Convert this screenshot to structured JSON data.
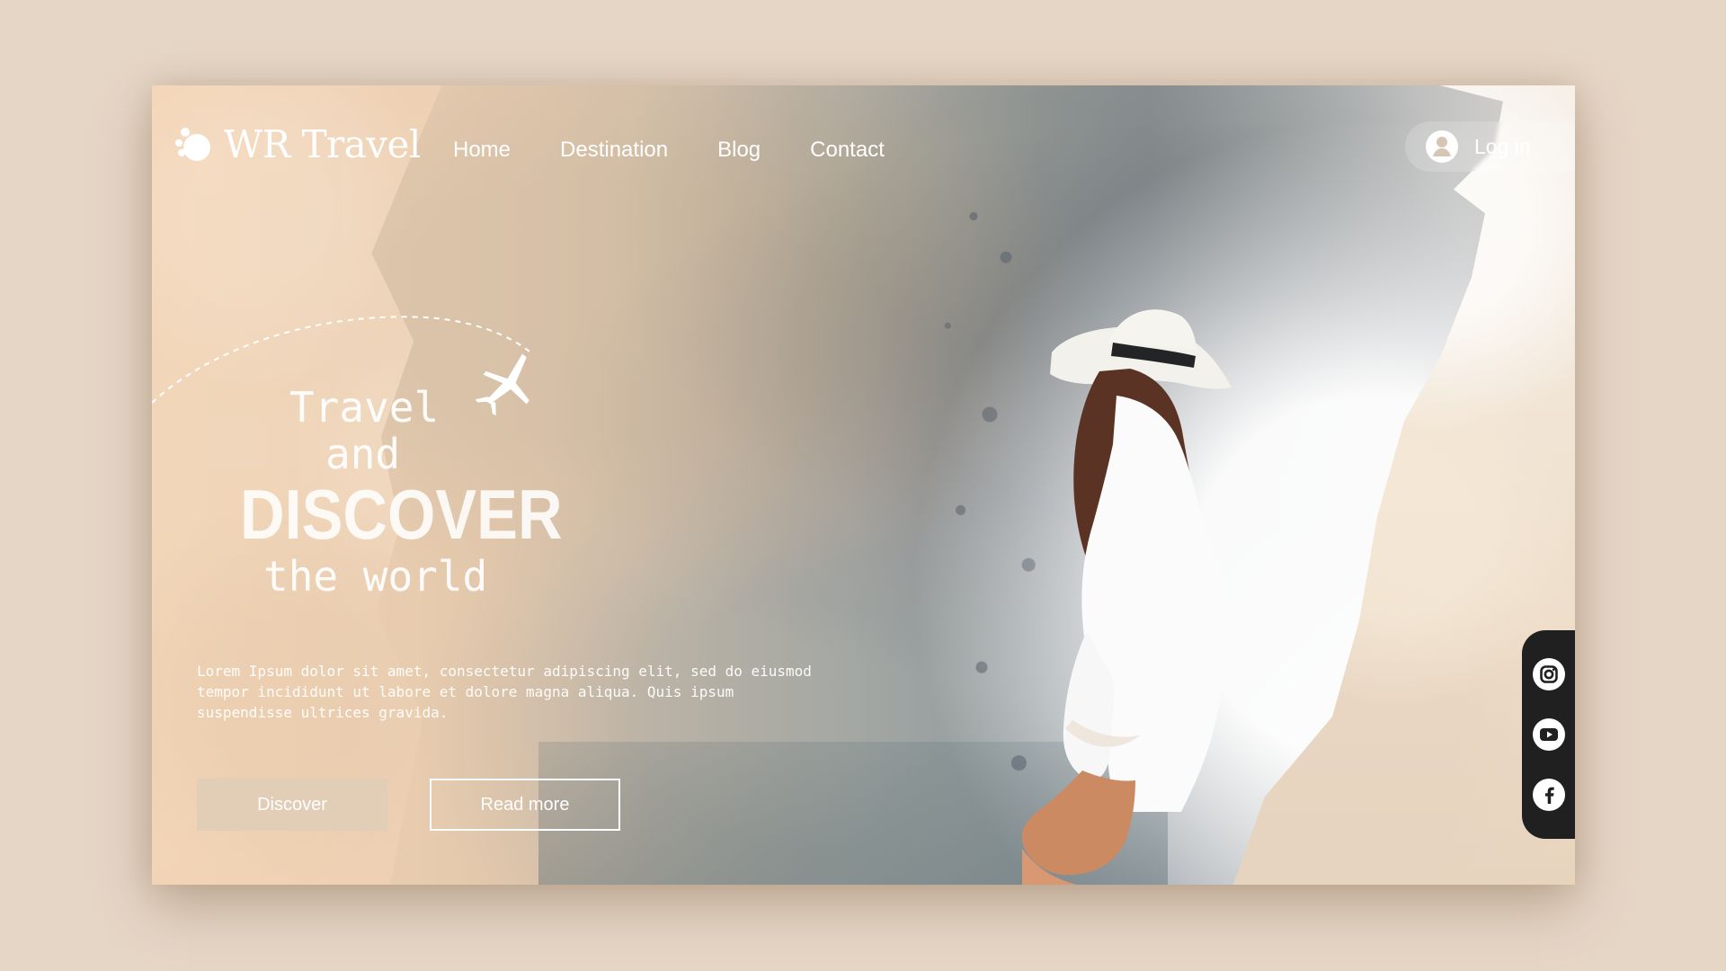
{
  "brand": {
    "name": "WR Travel"
  },
  "nav": {
    "items": [
      {
        "label": "Home"
      },
      {
        "label": "Destination"
      },
      {
        "label": "Blog"
      },
      {
        "label": "Contact"
      }
    ]
  },
  "auth": {
    "login_label": "Log in"
  },
  "hero": {
    "line_1": "Travel",
    "line_2": "and",
    "line_3": "DISCOVER",
    "line_4": "the world",
    "description": "Lorem Ipsum dolor sit amet, consectetur adipiscing elit, sed do eiusmod tempor incididunt ut labore et dolore magna aliqua. Quis ipsum suspendisse ultrices gravida."
  },
  "actions": {
    "discover_label": "Discover",
    "read_more_label": "Read more"
  },
  "icons": {
    "logo": "paw-logo-icon",
    "login": "user-icon",
    "plane": "plane-icon",
    "instagram": "instagram-icon",
    "youtube": "youtube-icon",
    "facebook": "facebook-icon"
  },
  "colors": {
    "background": "#e6d6c6",
    "button_fill": "#e2cdb7",
    "social_bar": "#202020",
    "text_light": "#ffffff"
  }
}
